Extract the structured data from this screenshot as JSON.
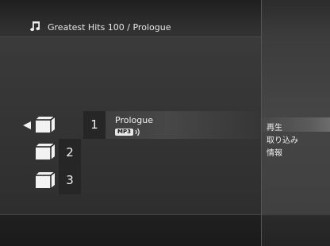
{
  "header": {
    "title": "Greatest Hits 100 / Prologue",
    "icon": "music-note-icon"
  },
  "tracks": [
    {
      "number": "1",
      "name": "Prologue",
      "format": "MP3",
      "selected": true
    },
    {
      "number": "2"
    },
    {
      "number": "3"
    }
  ],
  "menu": {
    "items": [
      {
        "label": "再生",
        "highlighted": true
      },
      {
        "label": "取り込み"
      },
      {
        "label": "情報"
      }
    ]
  },
  "colors": {
    "background": "#2e2e2e",
    "panel": "#404040",
    "text": "#f0f0f0"
  }
}
